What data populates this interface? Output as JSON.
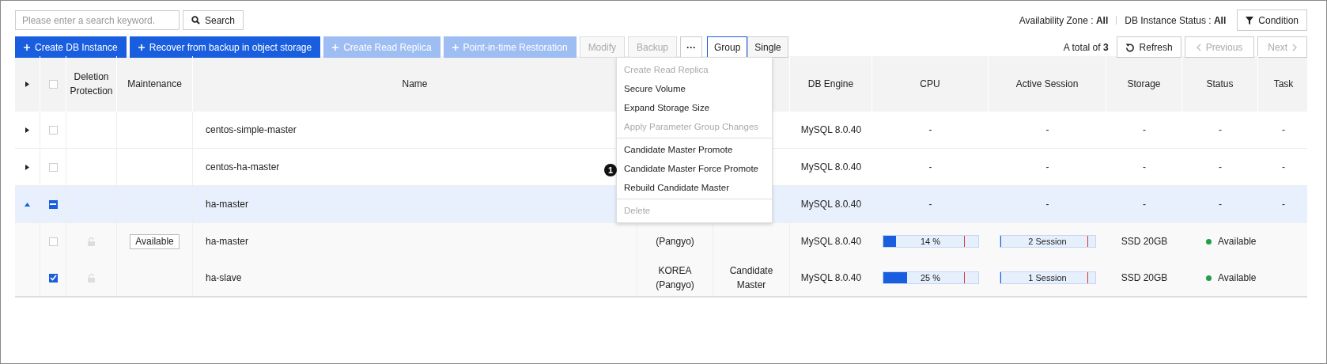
{
  "search": {
    "placeholder": "Please enter a search keyword.",
    "button": "Search"
  },
  "filters": [
    {
      "label": "Availability Zone :",
      "value": "All"
    },
    {
      "label": "DB Instance Status :",
      "value": "All"
    }
  ],
  "condition_button": "Condition",
  "actions": [
    {
      "kind": "primary",
      "label": "Create DB Instance",
      "disabled": false
    },
    {
      "kind": "primary",
      "label": "Recover from backup in object storage",
      "disabled": false
    },
    {
      "kind": "primary",
      "label": "Create Read Replica",
      "disabled": true
    },
    {
      "kind": "primary",
      "label": "Point-in-time Restoration",
      "disabled": true
    },
    {
      "kind": "plain",
      "label": "Modify",
      "disabled": true
    },
    {
      "kind": "plain",
      "label": "Backup",
      "disabled": true
    },
    {
      "kind": "more",
      "label": "···",
      "disabled": false
    }
  ],
  "view_toggle": [
    {
      "label": "Group",
      "selected": true
    },
    {
      "label": "Single",
      "selected": false
    }
  ],
  "total": {
    "text": "A total of",
    "count": "3"
  },
  "pager": {
    "refresh": "Refresh",
    "previous": "Previous",
    "next": "Next",
    "previous_disabled": true,
    "next_disabled": true
  },
  "table": {
    "header_checked": false,
    "columns": [
      "Deletion Protection",
      "Maintenance",
      "Name",
      "DB Engine",
      "CPU",
      "Active Session",
      "Storage",
      "Status",
      "Task"
    ],
    "rows": [
      {
        "kind": "group",
        "expanded": false,
        "selected": false,
        "checked": false,
        "indeterminate": false,
        "name": "centos-simple-master",
        "engine": "MySQL 8.0.40",
        "cpu": "-",
        "session": "-",
        "storage": "-",
        "status": "-",
        "task": "-"
      },
      {
        "kind": "group",
        "expanded": false,
        "selected": false,
        "checked": false,
        "indeterminate": false,
        "name": "centos-ha-master",
        "engine": "MySQL 8.0.40",
        "cpu": "-",
        "session": "-",
        "storage": "-",
        "status": "-",
        "task": "-"
      },
      {
        "kind": "group",
        "expanded": true,
        "selected": true,
        "indeterminate": true,
        "name": "ha-master",
        "engine": "MySQL 8.0.40",
        "cpu": "-",
        "session": "-",
        "storage": "-",
        "status": "-",
        "task": "-"
      },
      {
        "kind": "member",
        "selected": false,
        "checked": false,
        "deletion_protection": false,
        "maintenance": "Available",
        "name": "ha-master",
        "zone": "(Pangyo)",
        "engine": "MySQL 8.0.40",
        "cpu": {
          "level": 0.14,
          "reading": "14 %"
        },
        "session": {
          "level": 0.01,
          "reading": "2 Session"
        },
        "storage": "SSD 20GB",
        "status": {
          "text": "Available",
          "color": "#1ea04a"
        }
      },
      {
        "kind": "member",
        "selected": false,
        "checked": true,
        "deletion_protection": false,
        "name": "ha-slave",
        "zone": "KOREA (Pangyo)",
        "role": "Candidate Master",
        "engine": "MySQL 8.0.40",
        "cpu": {
          "level": 0.25,
          "reading": "25 %"
        },
        "session": {
          "level": 0.01,
          "reading": "1 Session"
        },
        "storage": "SSD 20GB",
        "status": {
          "text": "Available",
          "color": "#1ea04a"
        }
      }
    ]
  },
  "menu": [
    {
      "label": "Create Read Replica",
      "disabled": true,
      "divider_before": false
    },
    {
      "label": "Secure Volume",
      "disabled": false,
      "divider_before": false
    },
    {
      "label": "Expand Storage Size",
      "disabled": false,
      "divider_before": false
    },
    {
      "label": "Apply Parameter Group Changes",
      "disabled": true,
      "divider_before": false
    },
    {
      "label": "Candidate Master Promote",
      "disabled": false,
      "divider_before": true
    },
    {
      "label": "Candidate Master Force Promote",
      "disabled": false,
      "divider_before": false,
      "marker": "1"
    },
    {
      "label": "Rebuild Candidate Master",
      "disabled": false,
      "divider_before": false
    },
    {
      "label": "Delete",
      "disabled": true,
      "divider_before": true
    }
  ]
}
